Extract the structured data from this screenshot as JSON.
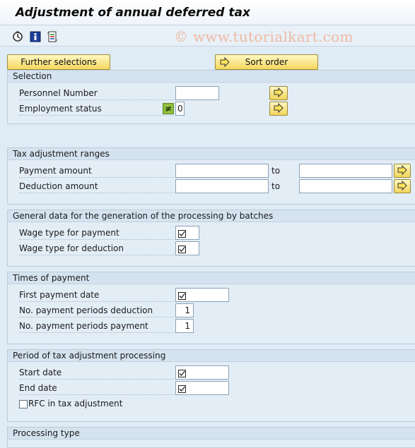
{
  "title": "Adjustment of annual deferred tax",
  "watermark": "© www.tutorialkart.com",
  "toolbar": {
    "icons": [
      "execute-icon",
      "information-icon",
      "variant-icon"
    ]
  },
  "buttons": {
    "further_selections": "Further selections",
    "sort_order": "Sort order"
  },
  "selection": {
    "heading": "Selection",
    "personnel_number": {
      "label": "Personnel Number",
      "value": ""
    },
    "employment_status": {
      "label": "Employment status",
      "operator": "≠",
      "value": "0"
    }
  },
  "tax_ranges": {
    "heading": "Tax adjustment ranges",
    "to_label": "to",
    "payment_amount": {
      "label": "Payment amount",
      "from": "",
      "to": ""
    },
    "deduction_amount": {
      "label": "Deduction amount",
      "from": "",
      "to": ""
    }
  },
  "general": {
    "heading": "General data for the generation of the processing by batches",
    "wage_payment": {
      "label": "Wage type for payment",
      "value": ""
    },
    "wage_deduction": {
      "label": "Wage type for deduction",
      "value": ""
    }
  },
  "times": {
    "heading": "Times of payment",
    "first_date": {
      "label": "First payment date",
      "value": ""
    },
    "periods_deduction": {
      "label": "No. payment periods deduction",
      "value": "1"
    },
    "periods_payment": {
      "label": "No. payment periods payment",
      "value": "1"
    }
  },
  "period": {
    "heading": "Period of tax adjustment processing",
    "start_date": {
      "label": "Start date",
      "value": ""
    },
    "end_date": {
      "label": "End date",
      "value": ""
    },
    "rfc": {
      "label": "RFC in tax adjustment",
      "checked": false
    }
  },
  "processing": {
    "heading": "Processing type"
  },
  "colors": {
    "background": "#dfebf5",
    "button": "#f6d85e",
    "operator": "#8fbf3f"
  }
}
